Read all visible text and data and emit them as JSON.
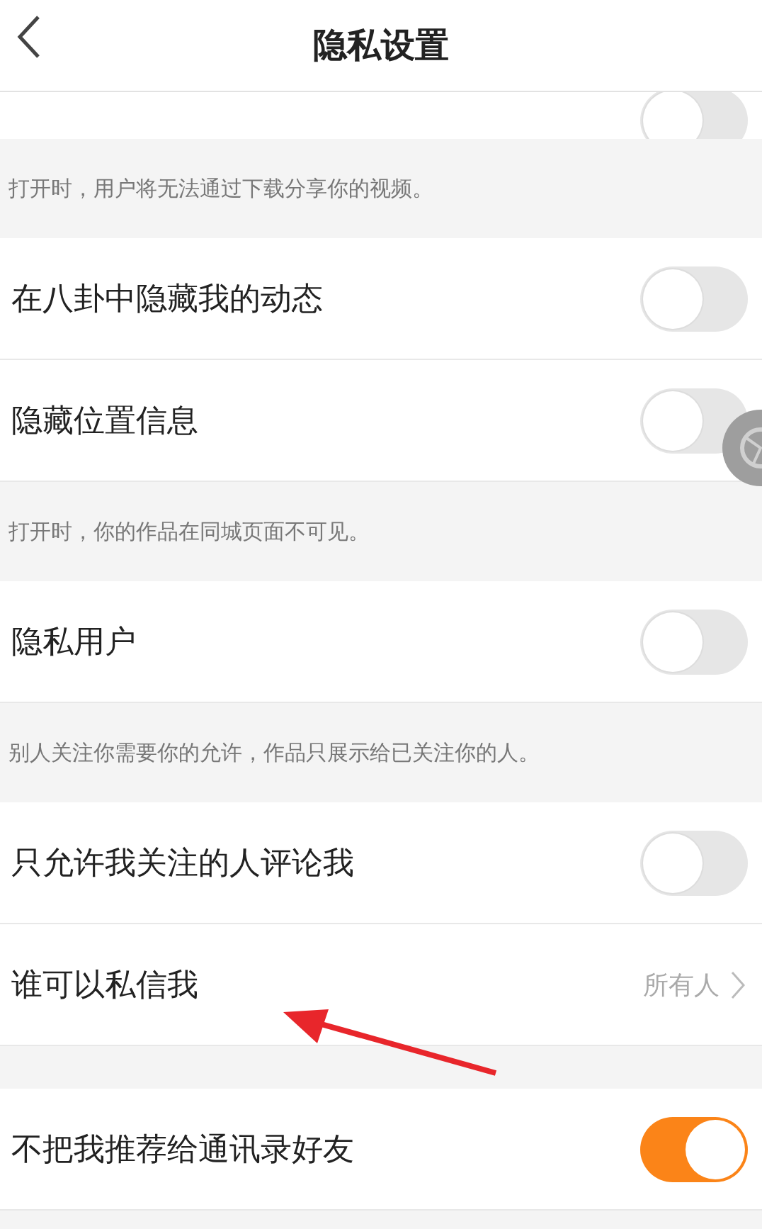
{
  "header": {
    "title": "隐私设置"
  },
  "items": [
    {
      "kind": "clipped_toggle",
      "on": false
    },
    {
      "kind": "note",
      "text": "打开时，用户将无法通过下载分享你的视频。"
    },
    {
      "kind": "toggle",
      "label": "在八卦中隐藏我的动态",
      "on": false
    },
    {
      "kind": "toggle",
      "label": "隐藏位置信息",
      "on": false
    },
    {
      "kind": "note",
      "text": "打开时，你的作品在同城页面不可见。"
    },
    {
      "kind": "toggle",
      "label": "隐私用户",
      "on": false
    },
    {
      "kind": "note",
      "text": "别人关注你需要你的允许，作品只展示给已关注你的人。"
    },
    {
      "kind": "toggle",
      "label": "只允许我关注的人评论我",
      "on": false
    },
    {
      "kind": "link",
      "label": "谁可以私信我",
      "value": "所有人"
    },
    {
      "kind": "spacer"
    },
    {
      "kind": "toggle",
      "label": "不把我推荐给通讯录好友",
      "on": true
    }
  ]
}
